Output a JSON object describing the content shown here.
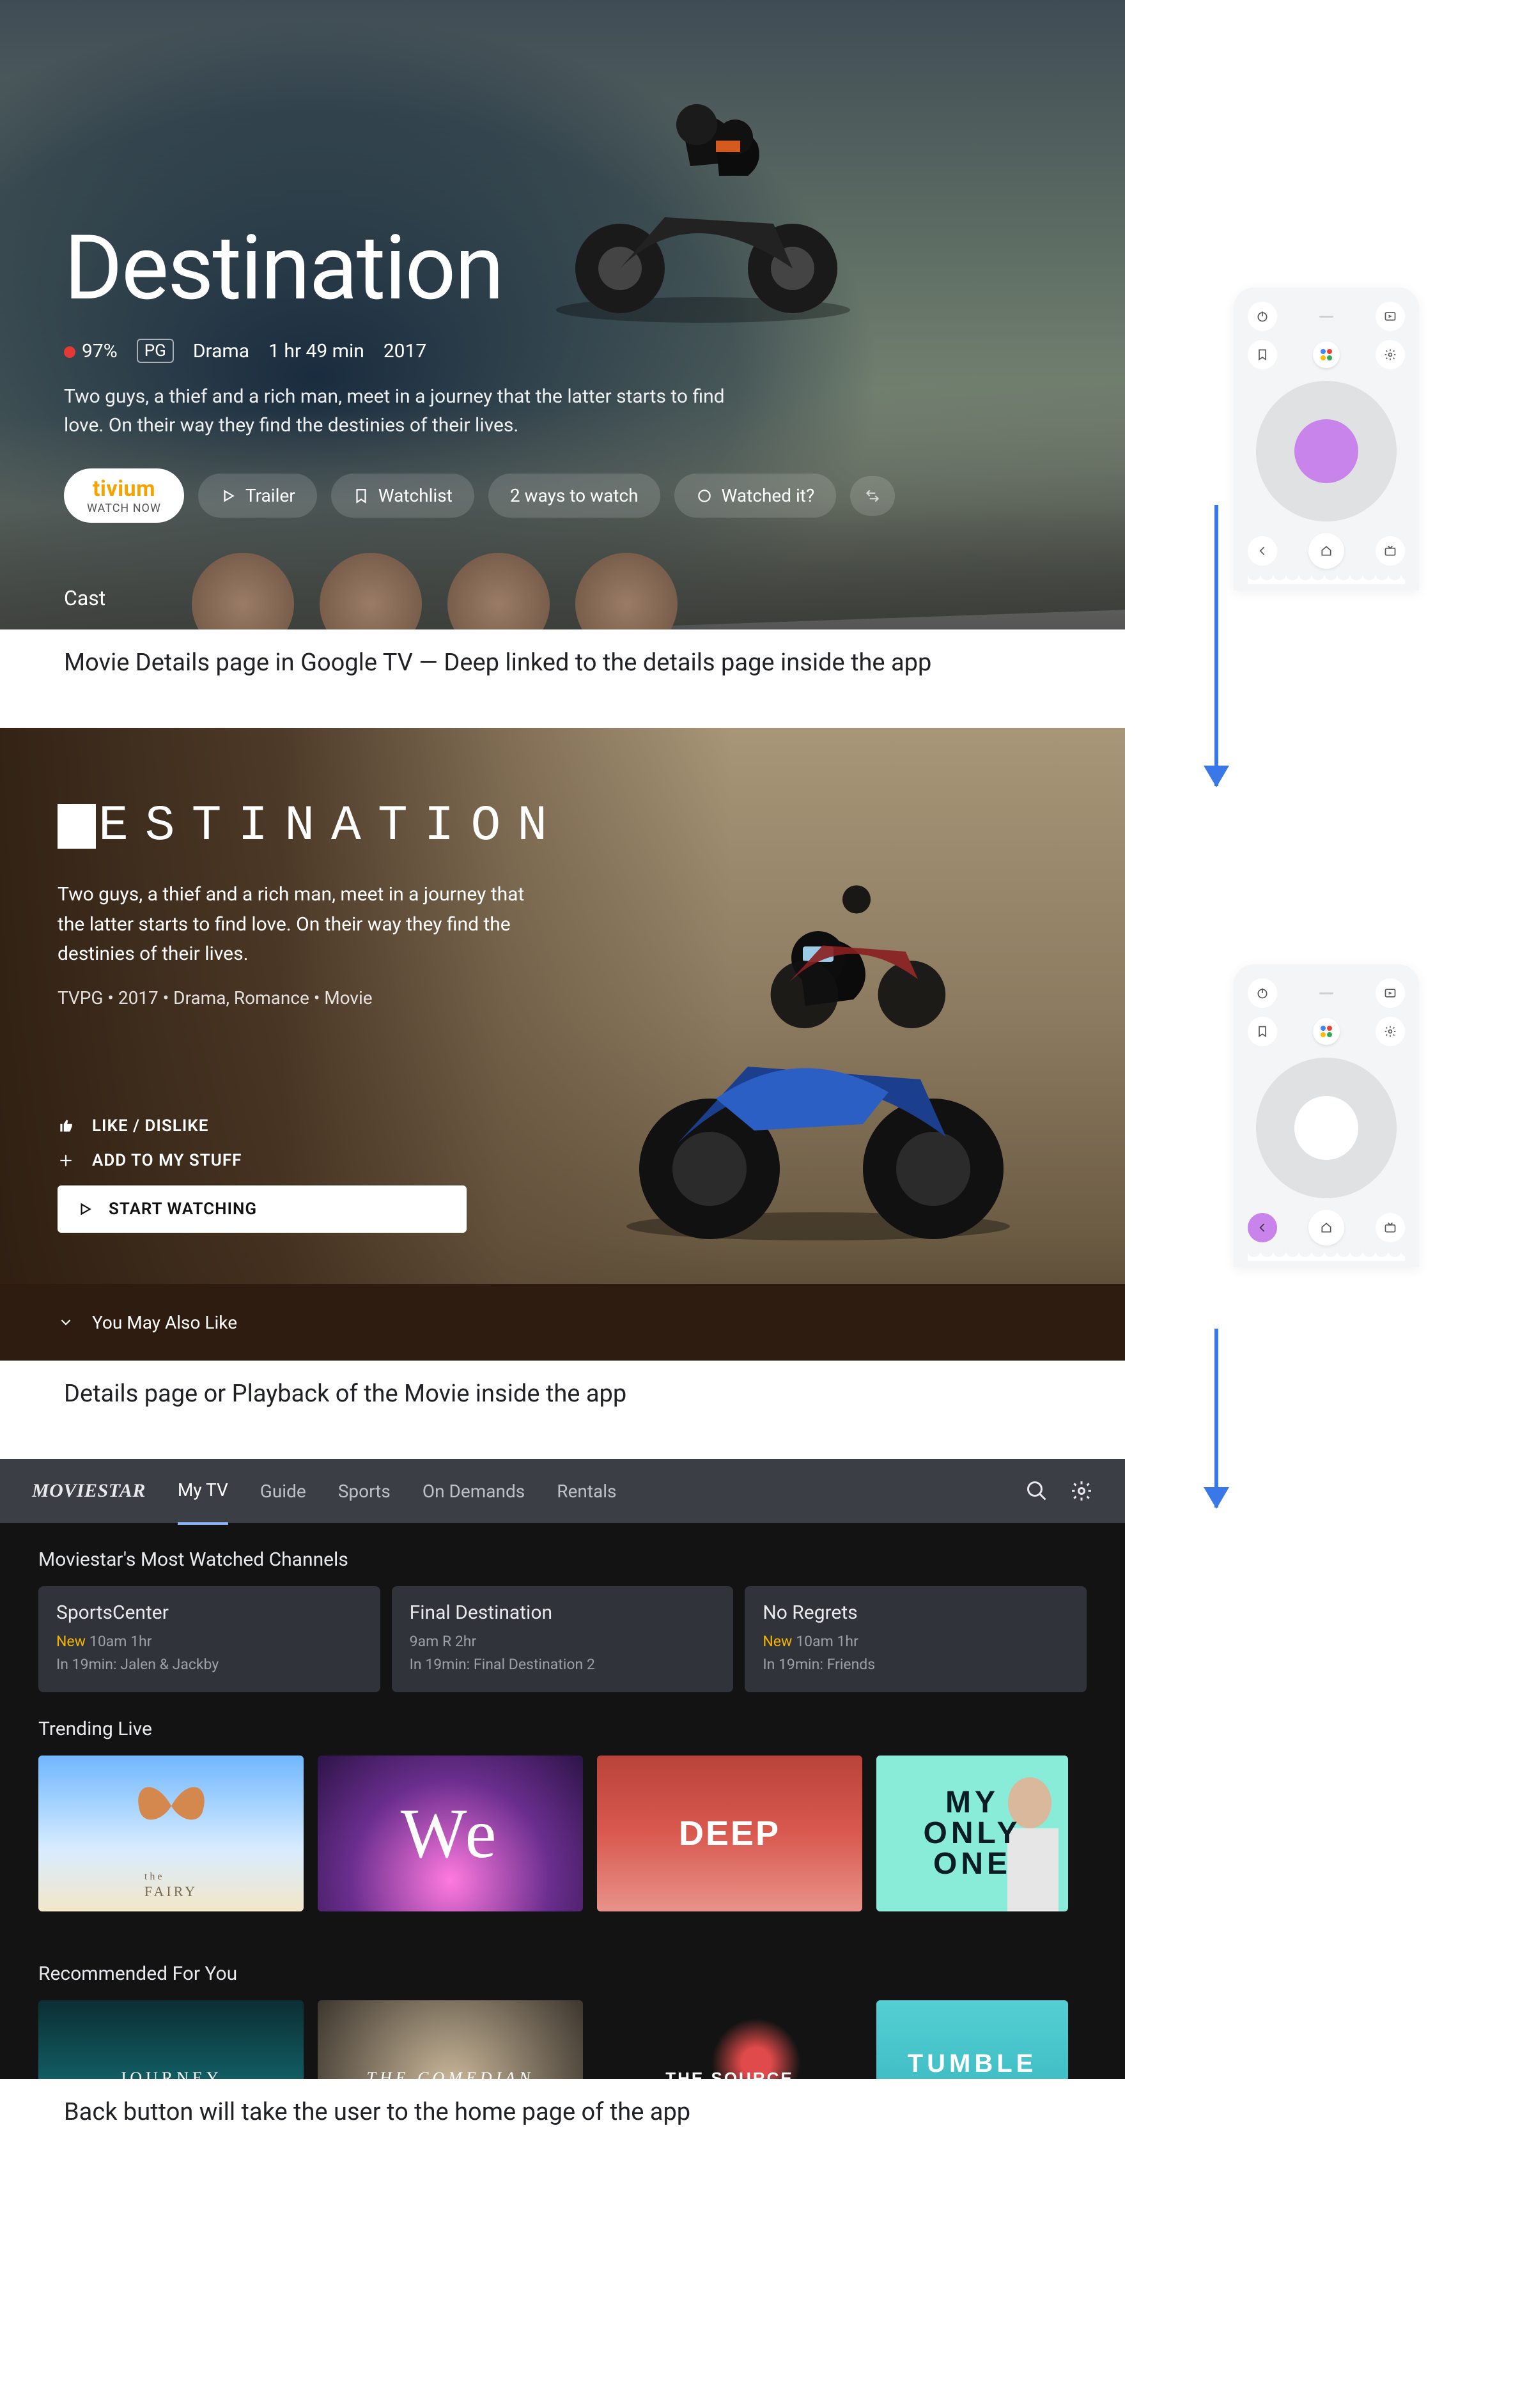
{
  "screen1": {
    "title": "Destination",
    "score": "97%",
    "rating": "PG",
    "genre": "Drama",
    "runtime": "1 hr 49 min",
    "year": "2017",
    "description": "Two guys, a thief and a rich man, meet in a journey that the latter starts to find love. On their way they find the destinies of their lives.",
    "actions": {
      "primary_brand": "tivium",
      "primary_sub": "WATCH NOW",
      "trailer": "Trailer",
      "watchlist": "Watchlist",
      "ways": "2 ways to watch",
      "watched": "Watched it?"
    },
    "cast_label": "Cast",
    "caption": "Movie Details page in Google TV — Deep linked to the details page inside the app"
  },
  "screen2": {
    "title_rest": "ESTINATION",
    "description": "Two guys, a thief and a rich man, meet in a journey that the latter starts to find love. On their way they find the destinies of their lives.",
    "meta": "TVPG • 2017 • Drama, Romance • Movie",
    "like": "LIKE / DISLIKE",
    "add": "ADD TO MY STUFF",
    "start": "START WATCHING",
    "also": "You May Also Like",
    "caption": "Details page or Playback of the Movie inside the app"
  },
  "screen3": {
    "brand": "MOVIESTAR",
    "tabs": [
      "My TV",
      "Guide",
      "Sports",
      "On Demands",
      "Rentals"
    ],
    "section1": "Moviestar's Most Watched Channels",
    "cards": [
      {
        "title": "SportsCenter",
        "new": "New",
        "time": "10am 1hr",
        "next": "In 19min: Jalen & Jackby"
      },
      {
        "title": "Final Destination",
        "new": "",
        "time": "9am R 2hr",
        "next": "In 19min: Final Destination 2"
      },
      {
        "title": "No Regrets",
        "new": "New",
        "time": "10am 1hr",
        "next": "In 19min: Friends"
      }
    ],
    "section2": "Trending Live",
    "tiles1": [
      {
        "label": "FAIRY",
        "sub": "the"
      },
      {
        "label": "We"
      },
      {
        "label": "DEEP"
      },
      {
        "label": "MY\nONLY\nONE"
      }
    ],
    "section3": "Recommended For You",
    "tiles2": [
      {
        "label": "JOURNEY"
      },
      {
        "label": "THE COMEDIAN"
      },
      {
        "label": "THE SOURCE"
      },
      {
        "label": "TUMBLE\nDRY"
      }
    ],
    "caption": "Back button will take the user to the home page of the app"
  },
  "remote_icons": {
    "power": "power-icon",
    "input": "input-icon",
    "bookmark": "bookmark-icon",
    "settings": "gear-icon",
    "back": "back-arrow-icon",
    "home": "home-icon",
    "tv": "tv-icon",
    "assistant": "assistant-icon"
  }
}
